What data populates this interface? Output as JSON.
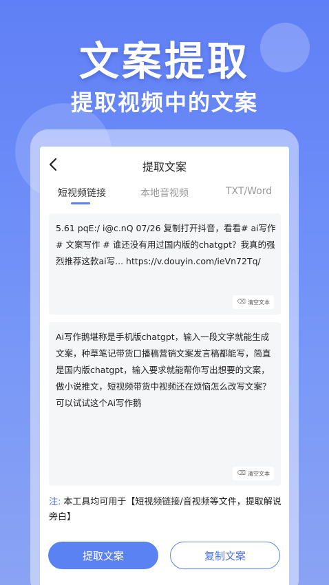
{
  "hero": {
    "title": "文案提取",
    "subtitle": "提取视频中的文案"
  },
  "nav": {
    "back_icon": "chevron-left-icon",
    "title": "提取文案"
  },
  "tabs": [
    {
      "label": "短视频链接",
      "active": true
    },
    {
      "label": "本地音视频",
      "active": false
    },
    {
      "label": "TXT/Word",
      "active": false
    }
  ],
  "input_box": {
    "text": "5.61 pqE:/ i@c.nQ 07/26 复制打开抖音，看看# ai写作 # 文案写作 # 谁还没有用过国内版的chatgpt？我真的强烈推荐这款ai写... https://v.douyin.com/ieVn72Tq/",
    "clear_label": "清空文本"
  },
  "output_box": {
    "text": " Ai写作鹅堪称是手机版chatgpt，输入一段文字就能生成文案，种草笔记带货口播稿营销文案发言稿都能写，简直是国内版chatgpt，输入要求就能帮你写出想要的文案，做小说推文，短视频带货中视频还在烦恼怎么改写文案？可以试试这个Ai写作鹅",
    "clear_label": "清空文本"
  },
  "note": {
    "label": "注:",
    "text": "本工具均可用于【短视频链接/音视频等文件，提取解说旁白】"
  },
  "buttons": {
    "extract_label": "提取文案",
    "copy_label": "复制文案"
  },
  "colors": {
    "accent": "#5b82f2",
    "background": "#6b8bf8"
  }
}
